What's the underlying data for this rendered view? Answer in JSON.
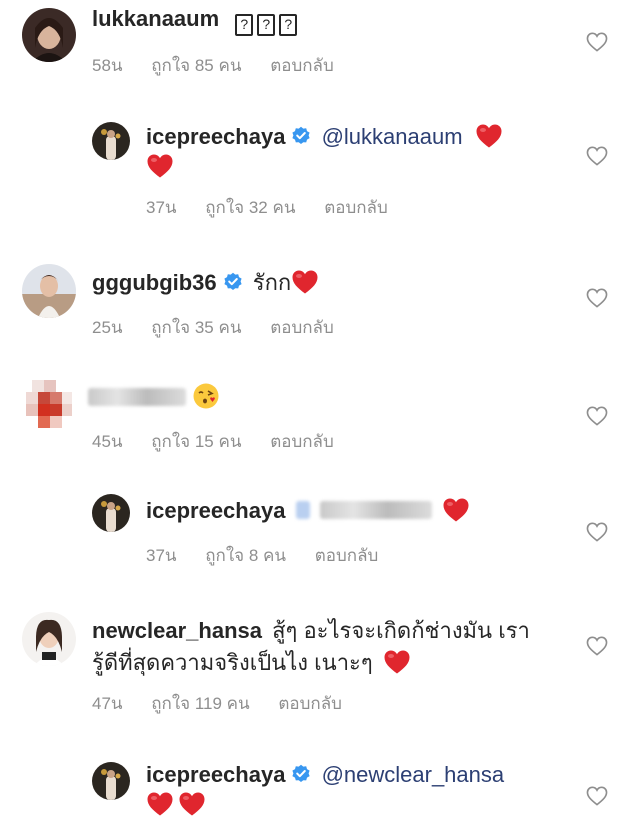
{
  "comments": [
    {
      "username": "lukkanaaum",
      "text_boxes": [
        "?",
        "?",
        "?"
      ],
      "time": "58น",
      "likes": "ถูกใจ 85 คน",
      "reply": "ตอบกลับ"
    },
    {
      "username": "icepreechaya",
      "mention": "@lukkanaaum",
      "time": "37น",
      "likes": "ถูกใจ 32 คน",
      "reply": "ตอบกลับ"
    },
    {
      "username": "gggubgib36",
      "text": "รักก",
      "time": "25น",
      "likes": "ถูกใจ 35 คน",
      "reply": "ตอบกลับ"
    },
    {
      "time": "45น",
      "likes": "ถูกใจ 15 คน",
      "reply": "ตอบกลับ"
    },
    {
      "username": "icepreechaya",
      "time": "37น",
      "likes": "ถูกใจ 8 คน",
      "reply": "ตอบกลับ"
    },
    {
      "username": "newclear_hansa",
      "text_line1": "สู้ๆ อะไรจะเกิดก้ช่างมัน เรา",
      "text_line2": "รู้ดีที่สุดความจริงเป็นไง เนาะๆ",
      "time": "47น",
      "likes": "ถูกใจ 119 คน",
      "reply": "ตอบกลับ"
    },
    {
      "username": "icepreechaya",
      "mention": "@newclear_hansa"
    }
  ],
  "icons": {
    "like": "heart-outline-icon",
    "verified": "verified-badge-icon",
    "emoji_heart": "red-heart-emoji",
    "emoji_kiss": "face-blowing-kiss-emoji"
  },
  "colors": {
    "text": "#262626",
    "meta": "#8e8e8e",
    "verified": "#3897f0",
    "heart": "#ed4956",
    "mention": "#2c3f73"
  }
}
